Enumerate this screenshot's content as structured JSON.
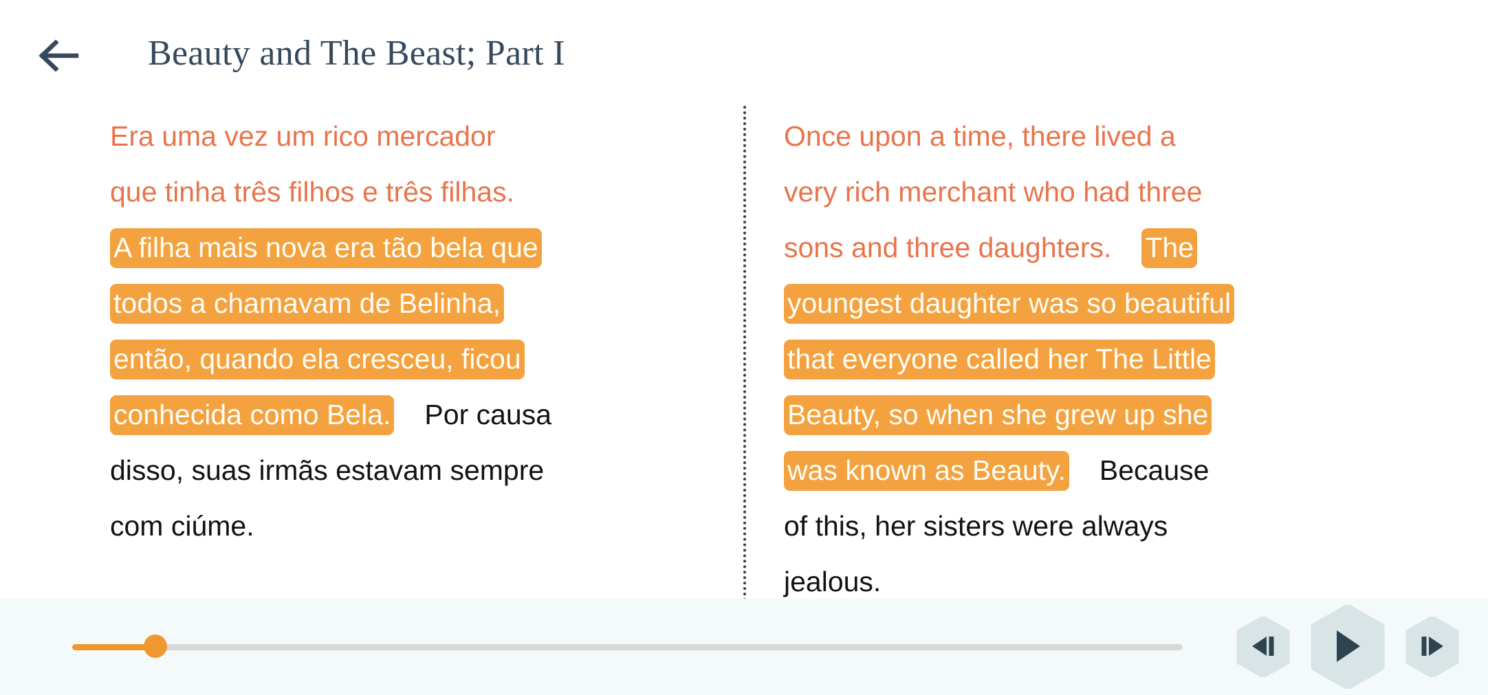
{
  "header": {
    "back_icon": "arrow-left-icon",
    "title": "Beauty and The Beast; Part I",
    "title_color": "#36495C"
  },
  "colors": {
    "highlight_bg": "#F3A23F",
    "highlight_text": "#FFFDF5",
    "spoken_text": "#E8744C",
    "plain_text": "#121212",
    "accent": "#F0982F",
    "player_bg": "#F4FAFA",
    "hex_button_bg": "#D8E4E6",
    "hex_glyph": "#2D4350"
  },
  "reader": {
    "divider": "dotted-vertical-divider",
    "left_column": {
      "language": "pt",
      "lines": [
        [
          {
            "text": "Era uma vez um rico mercador",
            "style": "coral"
          }
        ],
        [
          {
            "text": "que tinha três filhos e três filhas.",
            "style": "coral"
          }
        ],
        [
          {
            "text": "A filha mais nova era tão bela que",
            "style": "highlight"
          }
        ],
        [
          {
            "text": "todos a chamavam de Belinha,",
            "style": "highlight"
          }
        ],
        [
          {
            "text": "então, quando ela cresceu, ficou",
            "style": "highlight"
          }
        ],
        [
          {
            "text": "conhecida como Bela.",
            "style": "highlight"
          },
          {
            "text": "Por causa",
            "style": "plain",
            "gap_before": true
          }
        ],
        [
          {
            "text": "disso, suas irmãs estavam sempre",
            "style": "plain"
          }
        ],
        [
          {
            "text": "com ciúme.",
            "style": "plain"
          }
        ]
      ]
    },
    "right_column": {
      "language": "en",
      "lines": [
        [
          {
            "text": "Once upon a time, there lived a",
            "style": "coral"
          }
        ],
        [
          {
            "text": "very rich merchant who had three",
            "style": "coral"
          }
        ],
        [
          {
            "text": "sons and three daughters.",
            "style": "coral"
          },
          {
            "text": "The",
            "style": "highlight",
            "gap_before": true
          }
        ],
        [
          {
            "text": "youngest daughter was so beautiful",
            "style": "highlight"
          }
        ],
        [
          {
            "text": "that everyone called her The Little",
            "style": "highlight"
          }
        ],
        [
          {
            "text": "Beauty, so when she grew up she",
            "style": "highlight"
          }
        ],
        [
          {
            "text": "was known as Beauty.",
            "style": "highlight"
          },
          {
            "text": "Because",
            "style": "plain",
            "gap_before": true
          }
        ],
        [
          {
            "text": "of this, her sisters were always",
            "style": "plain"
          }
        ],
        [
          {
            "text": "jealous.",
            "style": "plain"
          }
        ]
      ]
    }
  },
  "player": {
    "progress_percent": 7.5,
    "previous_label": "previous-sentence",
    "play_label": "play",
    "next_label": "next-sentence"
  }
}
